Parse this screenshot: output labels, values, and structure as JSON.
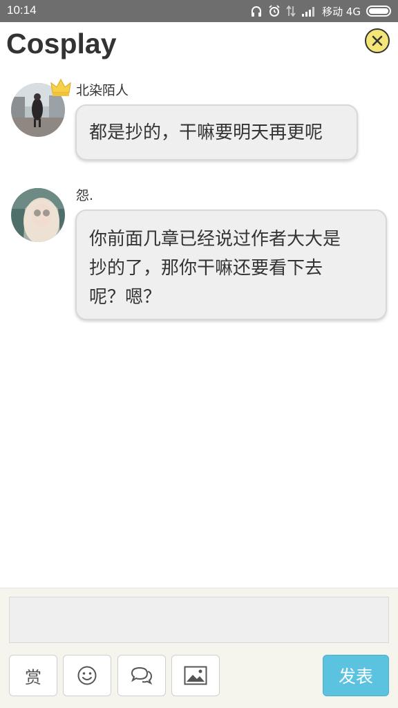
{
  "status_bar": {
    "time": "10:14",
    "carrier": "移动 4G",
    "icons": [
      "headphones-icon",
      "alarm-icon",
      "data-arrows-icon",
      "signal-icon",
      "battery-icon"
    ]
  },
  "header": {
    "title": "Cosplay",
    "close_icon": "close-circle-icon"
  },
  "comments": [
    {
      "username": "北染陌人",
      "text": "都是抄的，干嘛要明天再更呢",
      "badge": "crown-icon"
    },
    {
      "username": "怨.",
      "text_lines": [
        "你前面几章已经说过作者大大是",
        "抄的了，那你干嘛还要看下去",
        "呢？嗯？"
      ]
    }
  ],
  "composer": {
    "input_value": "",
    "reward_label": "赏",
    "emoji_icon": "smiley-icon",
    "chat_icon": "chat-bubbles-icon",
    "image_icon": "image-icon",
    "send_label": "发表"
  },
  "colors": {
    "status_bar_bg": "#6e6e6e",
    "send_button": "#5bc3e0",
    "close_button": "#f3e577",
    "bubble_bg": "#efefef"
  }
}
